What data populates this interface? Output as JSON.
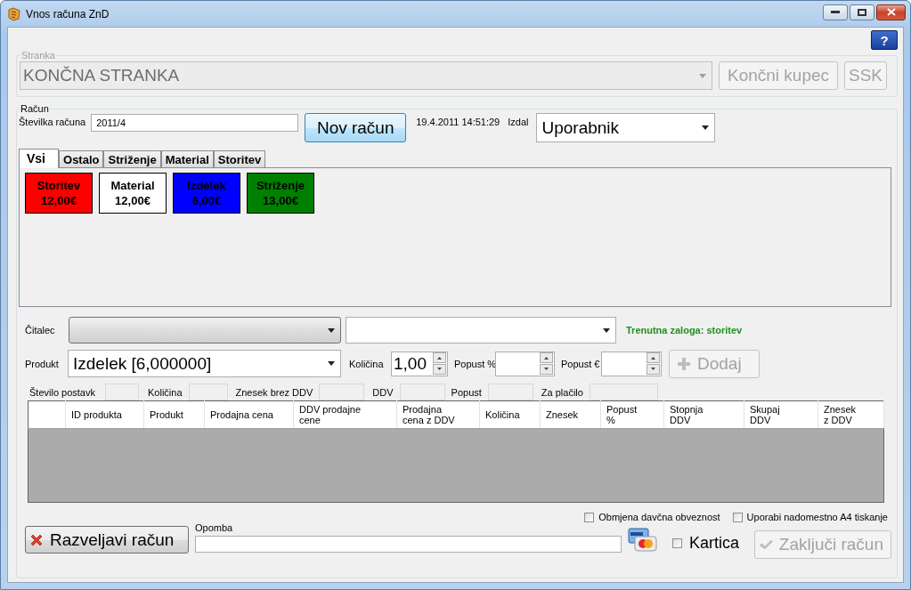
{
  "window": {
    "title": "Vnos računa ZnD"
  },
  "help": {
    "label": "?"
  },
  "stranka": {
    "legend": "Stranka",
    "value": "KONČNA STRANKA",
    "disabled": true,
    "buttons": [
      {
        "label": "Končni kupec",
        "disabled": true
      },
      {
        "label": "SSK",
        "disabled": true
      }
    ]
  },
  "racun": {
    "legend": "Račun",
    "number_label": "Številka računa",
    "number": "2011/4",
    "new_button": {
      "label": "Nov račun",
      "disabled": false
    },
    "datetime": "19.4.2011 14:51:29",
    "issuer_label": "Izdal",
    "issuer": "Uporabnik"
  },
  "tabs": [
    {
      "label": "Vsi",
      "selected": true
    },
    {
      "label": "Ostalo",
      "selected": false
    },
    {
      "label": "Striženje",
      "selected": false
    },
    {
      "label": "Material",
      "selected": false
    },
    {
      "label": "Storitev",
      "selected": false
    }
  ],
  "tiles": [
    {
      "name": "Storitev",
      "price": "12,00€",
      "color": "#ff0000"
    },
    {
      "name": "Material",
      "price": "12,00€",
      "color": "#ffffff"
    },
    {
      "name": "Izdelek",
      "price": "6,00€",
      "color": "#0000ff"
    },
    {
      "name": "Striženje",
      "price": "13,00€",
      "color": "#008000"
    }
  ],
  "reader": {
    "label": "Čitalec",
    "stock_text": "Trenutna zaloga: storitev"
  },
  "product": {
    "label": "Produkt",
    "value": "Izdelek [6,000000]",
    "quantity_label": "Količina",
    "quantity": "1,00",
    "discount_pct_label": "Popust %",
    "discount_eur_label": "Popust €",
    "add_button": {
      "label": "Dodaj",
      "disabled": true
    }
  },
  "summary": [
    "Število postavk",
    "Količina",
    "Znesek brez DDV",
    "DDV",
    "Popust",
    "Za plačilo"
  ],
  "table": {
    "columns": [
      "ID produkta",
      "Produkt",
      "Prodajna cena",
      "DDV prodajne\ncene",
      "Prodajna\ncena z DDV",
      "Količina",
      "Znesek",
      "Popust\n%",
      "Stopnja\nDDV",
      "Skupaj\nDDV",
      "Znesek\nz DDV"
    ]
  },
  "options": [
    {
      "label": "Obmjena davčna obveznost",
      "checked": false
    },
    {
      "label": "Uporabi nadomestno A4 tiskanje",
      "checked": false
    }
  ],
  "cancel_button": {
    "label": "Razveljavi račun",
    "disabled": false
  },
  "note": {
    "label": "Opomba"
  },
  "card": {
    "label": "Kartica",
    "checked": false
  },
  "finish_button": {
    "label": "Zaključi račun",
    "disabled": true
  }
}
